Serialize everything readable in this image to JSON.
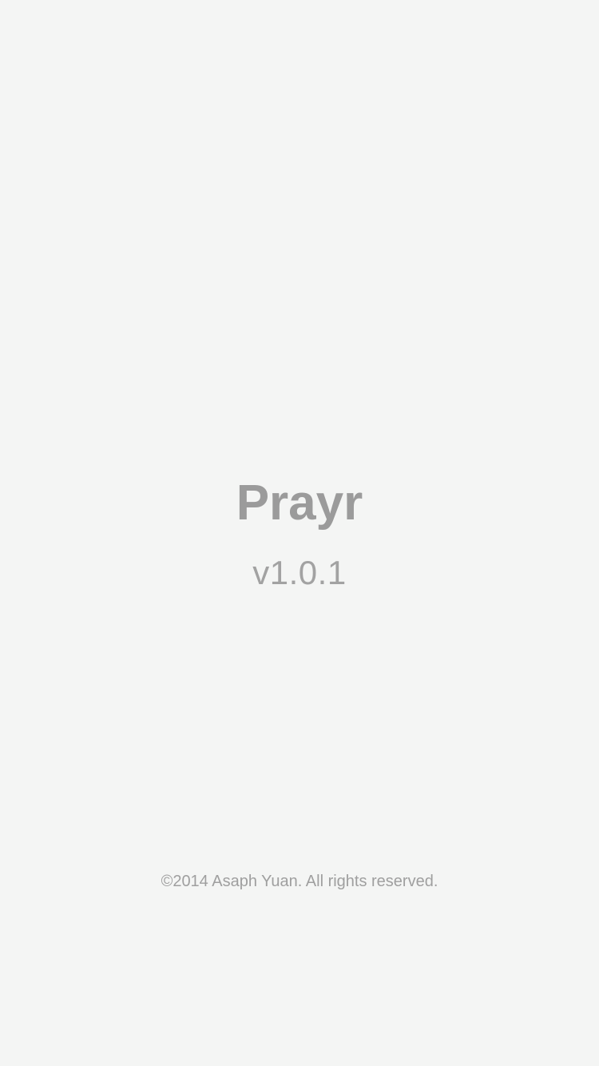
{
  "app": {
    "title": "Prayr",
    "version": "v1.0.1",
    "copyright": "©2014 Asaph Yuan. All rights reserved."
  },
  "colors": {
    "background": "#f4f5f4",
    "title": "#9b9b9b",
    "version": "#a2a2a2",
    "copyright": "#9f9f9f"
  }
}
